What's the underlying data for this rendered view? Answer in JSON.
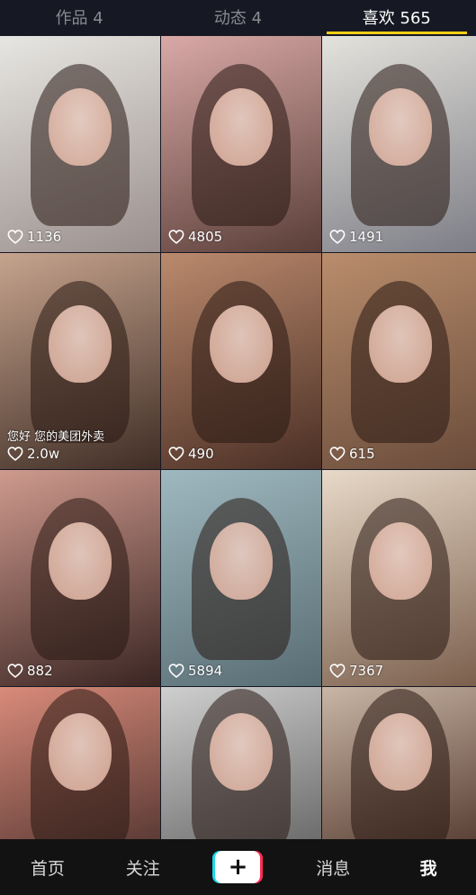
{
  "tabs": [
    {
      "label": "作品 4",
      "active": false
    },
    {
      "label": "动态 4",
      "active": false
    },
    {
      "label": "喜欢 565",
      "active": true
    }
  ],
  "accent_color": "#face15",
  "videos": [
    {
      "likes": "1136",
      "bg": [
        "#e7e6e2",
        "#9a8f8c"
      ]
    },
    {
      "likes": "4805",
      "bg": [
        "#d9a9a7",
        "#5a3e38"
      ]
    },
    {
      "likes": "1491",
      "bg": [
        "#e4e2dc",
        "#7d7e86"
      ]
    },
    {
      "likes": "2.0w",
      "bg": [
        "#c6a48e",
        "#3f2d25"
      ]
    },
    {
      "likes": "490",
      "bg": [
        "#bb8a6d",
        "#4a2f25"
      ]
    },
    {
      "likes": "615",
      "bg": [
        "#b98d6c",
        "#6a4c3b"
      ]
    },
    {
      "likes": "882",
      "bg": [
        "#cf9a8e",
        "#3a2522"
      ]
    },
    {
      "likes": "5894",
      "bg": [
        "#9fb8bf",
        "#586c73"
      ]
    },
    {
      "likes": "7367",
      "bg": [
        "#e8d9c8",
        "#7b5f4d"
      ]
    },
    {
      "likes": "",
      "bg": [
        "#d98b7a",
        "#5b3a35"
      ]
    },
    {
      "likes": "",
      "bg": [
        "#cfcfcf",
        "#6b6b6b"
      ]
    },
    {
      "likes": "",
      "bg": [
        "#c9b6a5",
        "#5a4035"
      ]
    }
  ],
  "overlay_caption": "您好 您的美团外卖",
  "bottom_nav": {
    "home": "首页",
    "follow": "关注",
    "create": "+",
    "messages": "消息",
    "me": "我"
  }
}
